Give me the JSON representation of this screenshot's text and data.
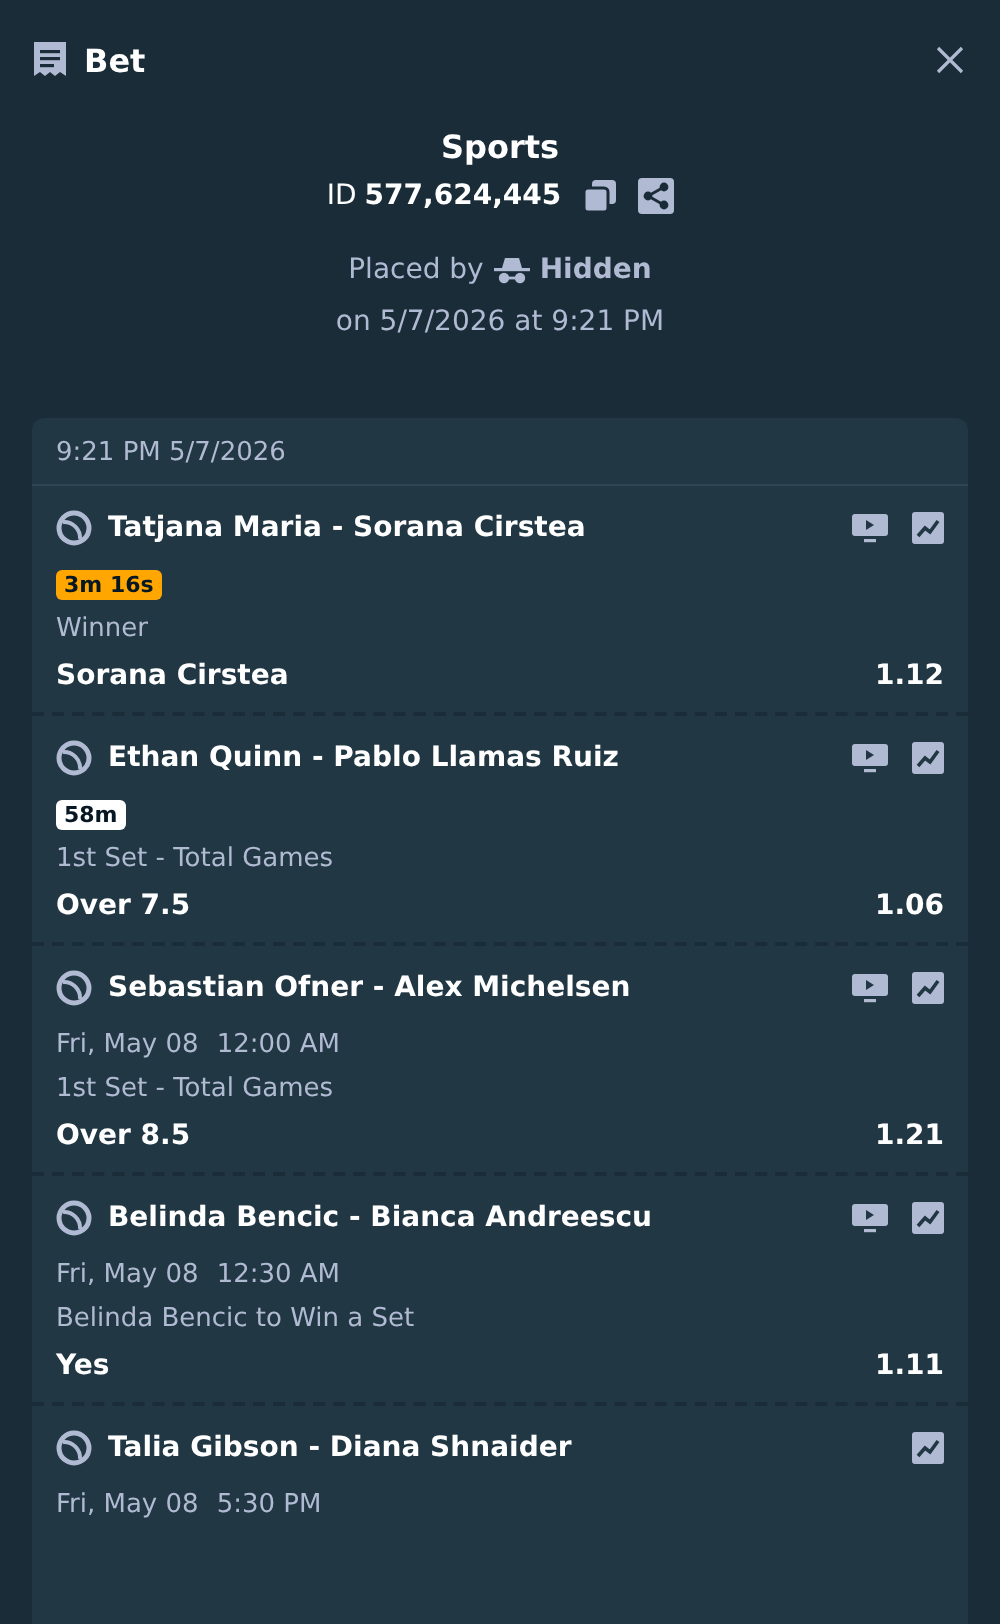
{
  "header": {
    "title": "Bet"
  },
  "summary": {
    "category": "Sports",
    "id_label": "ID",
    "id_value": "577,624,445",
    "placed_by_label": "Placed by",
    "placed_by_user": "Hidden",
    "placed_on": "on 5/7/2026 at 9:21 PM"
  },
  "slip": {
    "timestamp": "9:21 PM 5/7/2026",
    "events": [
      {
        "name": "Tatjana Maria - Sorana Cirstea",
        "live_stream": true,
        "badge": {
          "text": "3m 16s",
          "color": "#ffa600"
        },
        "market": "Winner",
        "selection": "Sorana Cirstea",
        "odds": "1.12"
      },
      {
        "name": "Ethan Quinn - Pablo Llamas Ruiz",
        "live_stream": true,
        "badge": {
          "text": "58m",
          "color": "#ffffff"
        },
        "market": "1st Set - Total Games",
        "selection": "Over 7.5",
        "odds": "1.06"
      },
      {
        "name": "Sebastian Ofner - Alex Michelsen",
        "live_stream": true,
        "date": "Fri, May 08",
        "time": "12:00 AM",
        "market": "1st Set - Total Games",
        "selection": "Over 8.5",
        "odds": "1.21"
      },
      {
        "name": "Belinda Bencic - Bianca Andreescu",
        "live_stream": true,
        "date": "Fri, May 08",
        "time": "12:30 AM",
        "market": "Belinda Bencic to Win a Set",
        "selection": "Yes",
        "odds": "1.11"
      },
      {
        "name": "Talia Gibson - Diana Shnaider",
        "live_stream": false,
        "date": "Fri, May 08",
        "time": "5:30 PM"
      }
    ]
  }
}
